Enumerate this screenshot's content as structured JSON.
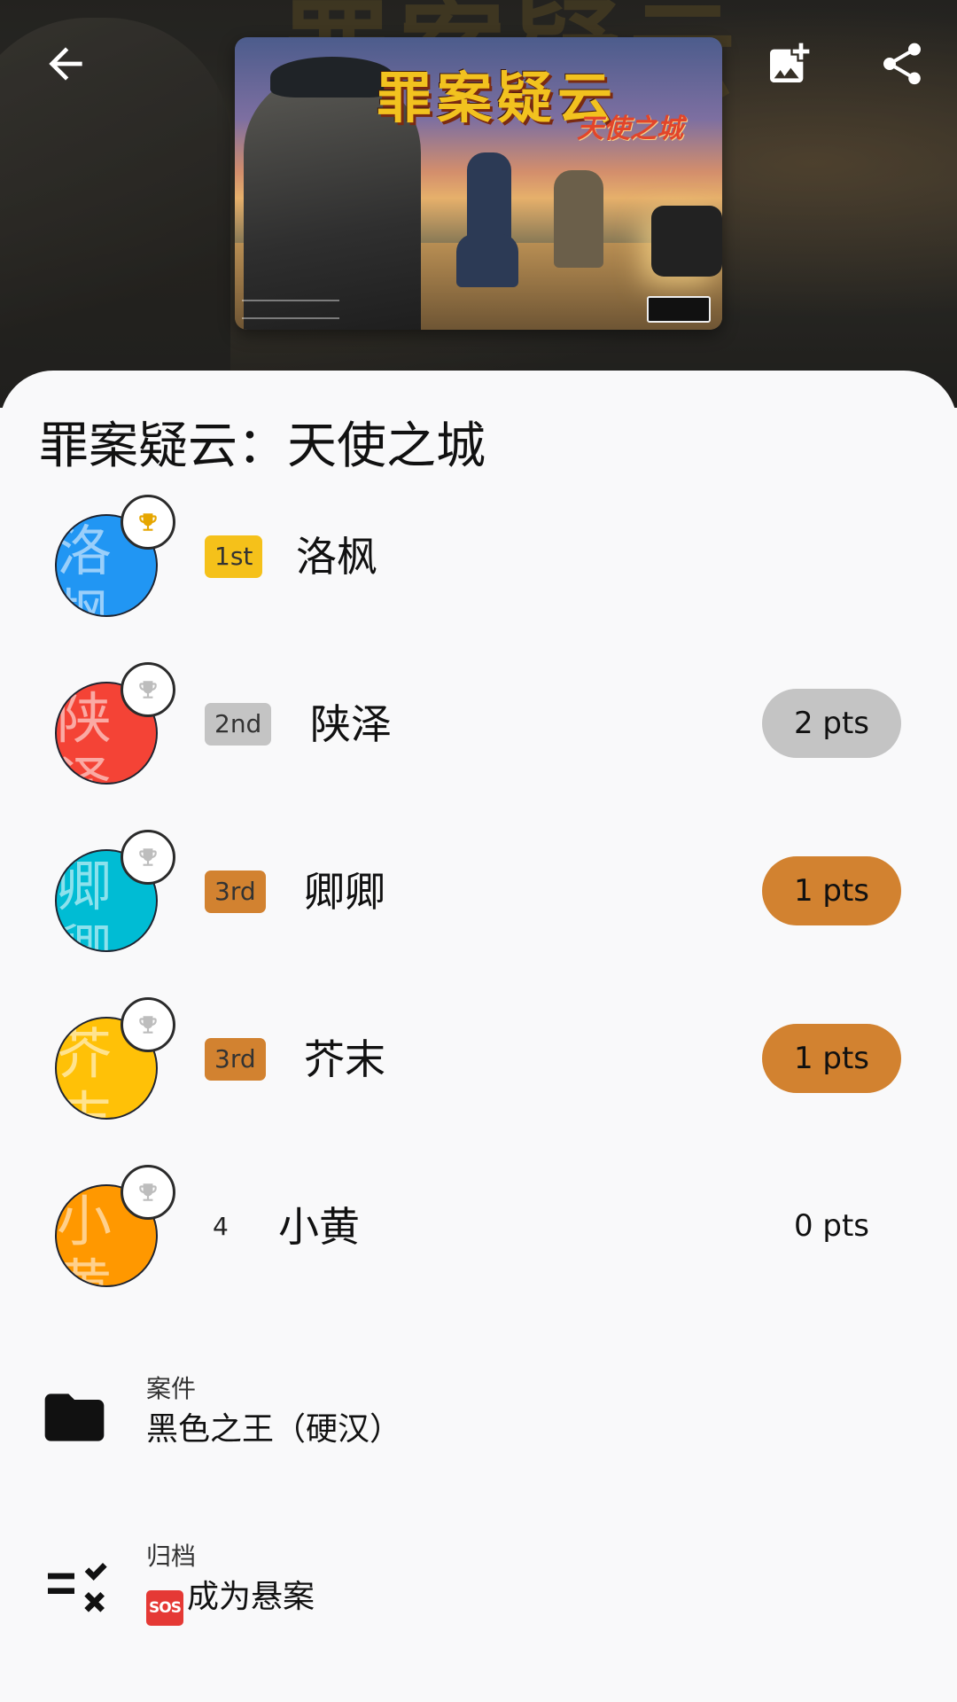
{
  "header": {
    "back_icon": "arrow-back-icon",
    "add_photo_icon": "add-photo-icon",
    "share_icon": "share-icon",
    "cover_title": "罪案疑云",
    "cover_subtitle": "天使之城"
  },
  "game": {
    "title": "罪案疑云：天使之城"
  },
  "players": [
    {
      "name": "洛枫",
      "initials": "洛\n枫",
      "rank": "1st",
      "points": "",
      "avatar_color": "#2196f3",
      "trophy_color": "#e6a600",
      "rank_color": "#f5c11a",
      "pts_color": ""
    },
    {
      "name": "陕泽",
      "initials": "陕\n泽",
      "rank": "2nd",
      "points": "2 pts",
      "avatar_color": "#f44336",
      "trophy_color": "#bdbdbd",
      "rank_color": "#c4c4c4",
      "pts_color": "#c4c4c4"
    },
    {
      "name": "卿卿",
      "initials": "卿\n卿",
      "rank": "3rd",
      "points": "1 pts",
      "avatar_color": "#00bcd4",
      "trophy_color": "#bdbdbd",
      "rank_color": "#d28230",
      "pts_color": "#d28230"
    },
    {
      "name": "芥末",
      "initials": "芥\n末",
      "rank": "3rd",
      "points": "1 pts",
      "avatar_color": "#ffc107",
      "trophy_color": "#bdbdbd",
      "rank_color": "#d28230",
      "pts_color": "#d28230"
    },
    {
      "name": "小黄",
      "initials": "小\n黄",
      "rank": "4",
      "points": "0 pts",
      "avatar_color": "#ff9800",
      "trophy_color": "#bdbdbd",
      "rank_color": "",
      "pts_color": ""
    }
  ],
  "details": {
    "case_label": "案件",
    "case_value": "黑色之王（硬汉）",
    "case_icon": "folder-icon",
    "archive_label": "归档",
    "archive_badge": "SOS",
    "archive_value": "成为悬案",
    "archive_icon": "checklist-icon"
  }
}
